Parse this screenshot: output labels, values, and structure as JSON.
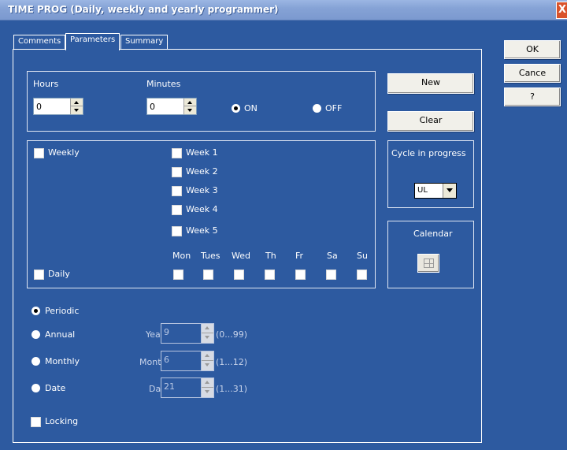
{
  "window": {
    "title": "TIME PROG (Daily, weekly and yearly programmer)",
    "close_glyph": "X"
  },
  "tabs": [
    {
      "label": "Comments",
      "active": false
    },
    {
      "label": "Parameters",
      "active": true
    },
    {
      "label": "Summary",
      "active": false
    }
  ],
  "dialog_buttons": {
    "ok": "OK",
    "cancel": "Cance",
    "help": "?"
  },
  "time": {
    "hours_label": "Hours",
    "hours_value": "0",
    "minutes_label": "Minutes",
    "minutes_value": "0",
    "on_label": "ON",
    "off_label": "OFF",
    "selected": "on"
  },
  "actions": {
    "new": "New",
    "clear": "Clear"
  },
  "schedule": {
    "weekly_label": "Weekly",
    "daily_label": "Daily",
    "weeks": [
      "Week 1",
      "Week 2",
      "Week 3",
      "Week 4",
      "Week 5"
    ],
    "days": [
      "Mon",
      "Tues",
      "Wed",
      "Th",
      "Fr",
      "Sa",
      "Su"
    ]
  },
  "cycle": {
    "label": "Cycle in progress",
    "value": "UL"
  },
  "calendar": {
    "label": "Calendar",
    "icon": "calendar-icon"
  },
  "mode": {
    "periodic": "Periodic",
    "annual": "Annual",
    "monthly": "Monthly",
    "date": "Date",
    "selected": "periodic"
  },
  "year": {
    "label": "Year",
    "value": "9",
    "range": "(0...99)"
  },
  "month": {
    "label": "Month",
    "value": "6",
    "range": "(1...12)"
  },
  "day": {
    "label": "Day",
    "value": "21",
    "range": "(1...31)"
  },
  "locking_label": "Locking",
  "colors": {
    "background": "#2d5aa0",
    "titlebar": "#86a3d6",
    "close": "#d9532c",
    "button_face": "#f1f0ea"
  }
}
